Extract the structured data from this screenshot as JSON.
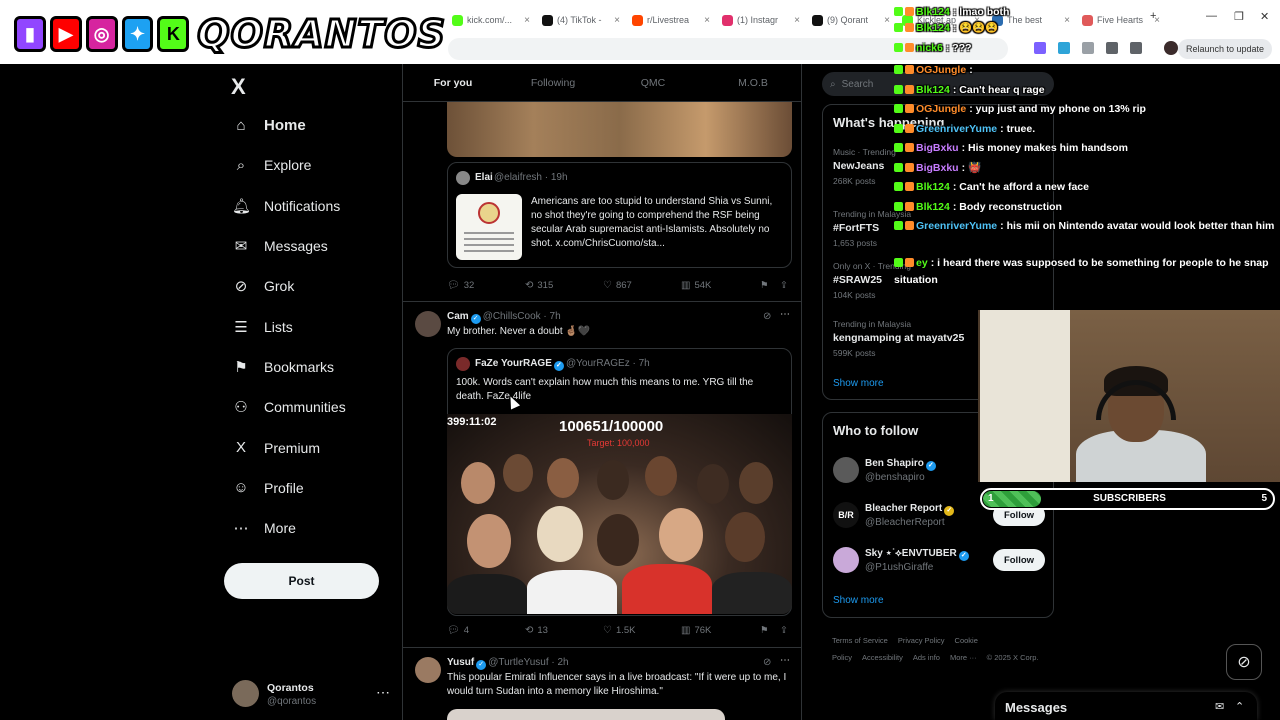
{
  "browser": {
    "tabs": [
      {
        "label": "kick.com/...",
        "color": "#53fc18"
      },
      {
        "label": "(4) TikTok -",
        "color": "#111111"
      },
      {
        "label": "r/Livestrea",
        "color": "#ff4500"
      },
      {
        "label": "(1) Instagr",
        "color": "#e1306c"
      },
      {
        "label": "(9) Qorant",
        "color": "#111111"
      },
      {
        "label": "Kicklet.ap",
        "color": "#53fc18"
      },
      {
        "label": "The best",
        "color": "#2b6cb0"
      },
      {
        "label": "Five Hearts",
        "color": "#e05a5a"
      }
    ],
    "new_tab": "+",
    "relaunch_label": "Relaunch to update"
  },
  "banner": {
    "name": "QORANTOS",
    "icons": [
      "twitch-icon",
      "youtube-icon",
      "instagram-icon",
      "twitter-icon",
      "kick-icon"
    ]
  },
  "nav": {
    "logo": "X",
    "items": [
      {
        "label": "Home",
        "icon": "⌂",
        "active": true
      },
      {
        "label": "Explore",
        "icon": "⌕"
      },
      {
        "label": "Notifications",
        "icon": "🔔︎"
      },
      {
        "label": "Messages",
        "icon": "✉"
      },
      {
        "label": "Grok",
        "icon": "⊘"
      },
      {
        "label": "Lists",
        "icon": "☰"
      },
      {
        "label": "Bookmarks",
        "icon": "⚑"
      },
      {
        "label": "Communities",
        "icon": "⚇"
      },
      {
        "label": "Premium",
        "icon": "X"
      },
      {
        "label": "Profile",
        "icon": "☺"
      },
      {
        "label": "More",
        "icon": "⋯"
      }
    ],
    "post_label": "Post",
    "account": {
      "name": "Qorantos",
      "handle": "@qorantos",
      "more": "⋯"
    }
  },
  "feed": {
    "tabs": [
      "For you",
      "Following",
      "QMC",
      "M.O.B"
    ],
    "quote1": {
      "name": "Elai",
      "handle": "@elaifresh · 19h",
      "text": "Americans are too stupid to understand Shia vs Sunni, no shot they're going to comprehend the RSF being secular Arab supremacist anti-Islamists. Absolutely no shot.  x.com/ChrisCuomo/sta..."
    },
    "actions1": {
      "reply": "32",
      "repost": "315",
      "like": "867",
      "views": "54K"
    },
    "tweet2": {
      "name": "Cam",
      "handle": "@ChillsCook · 7h",
      "text": "My brother. Never a doubt 🤞🏽🖤",
      "quote": {
        "name": "FaZe YourRAGE",
        "handle": "@YourRAGEz · 7h",
        "text": "100k. Words can't explain how much this means to me. YRG till the death. FaZe 4life"
      },
      "video": {
        "timer": "399:11:02",
        "count": "100651/100000",
        "target": "Target: 100,000"
      }
    },
    "actions2": {
      "reply": "4",
      "repost": "13",
      "like": "1.5K",
      "views": "76K"
    },
    "tweet3": {
      "name": "Yusuf",
      "handle": "@TurtleYusuf · 2h",
      "text": "This popular Emirati Influencer says in a live broadcast: \"If it were up to me, I would turn Sudan into a memory like Hiroshima.\""
    }
  },
  "right": {
    "search_placeholder": "Search",
    "happening_title": "What's happening",
    "trends": [
      {
        "category": "Music · Trending",
        "name": "NewJeans",
        "count": "268K posts"
      },
      {
        "category": "Trending in Malaysia",
        "name": "#FortFTS",
        "count": "1,653 posts"
      },
      {
        "category": "Only on X · Trending",
        "name": "#SRAW25",
        "count": "104K posts"
      },
      {
        "category": "Trending in Malaysia",
        "name": "kengnamping at mayatv25",
        "count": "599K posts"
      }
    ],
    "show_more": "Show more",
    "wtf_title": "Who to follow",
    "wtf": [
      {
        "name": "Ben Shapiro",
        "handle": "@benshapiro",
        "button": "Follow",
        "avatar": "#5a5a5a",
        "badge": "blue"
      },
      {
        "name": "Bleacher Report",
        "handle": "@BleacherReport",
        "button": "Follow",
        "avatar": "#111111",
        "badge": "gold",
        "mark": "B/R"
      },
      {
        "name": "Sky ⋆˙⟡ENVTUBER",
        "handle": "@P1ushGiraffe",
        "button": "Follow",
        "avatar": "#c9a9d9",
        "badge": "blue"
      }
    ],
    "footer": [
      "Terms of Service",
      "Privacy Policy",
      "Cookie Policy",
      "Accessibility",
      "Ads info",
      "More ···",
      "© 2025 X Corp."
    ],
    "messages_label": "Messages"
  },
  "chat": {
    "messages": [
      {
        "user": "Blk124",
        "text": "lmao both",
        "color": "#53fc18"
      },
      {
        "user": "Blk124",
        "text": "😫😫😫",
        "color": "#53fc18"
      },
      {
        "user": "nick6",
        "text": "???",
        "color": "#53fc18"
      },
      {
        "user": "OGJungle",
        "text": "",
        "color": "#ff8c2a"
      },
      {
        "user": "Blk124",
        "text": "Can't hear q rage",
        "color": "#53fc18"
      },
      {
        "user": "OGJungle",
        "text": "yup just    and my phone on 13% rip",
        "color": "#ff8c2a"
      },
      {
        "user": "GreenriverYume",
        "text": "truee.",
        "color": "#4fc3f7"
      },
      {
        "user": "BigBxku",
        "text": "His money makes him handsom",
        "color": "#c77dff"
      },
      {
        "user": "BigBxku",
        "text": "👹",
        "color": "#c77dff"
      },
      {
        "user": "Blk124",
        "text": "Can't he afford a new face",
        "color": "#53fc18"
      },
      {
        "user": "Blk124",
        "text": "Body reconstruction",
        "color": "#53fc18"
      },
      {
        "user": "GreenriverYume",
        "text": "his mii on Nintendo avatar would look better than him",
        "color": "#4fc3f7"
      },
      {
        "user": "ey",
        "text": "i heard there was supposed to be something for people to he snap situation",
        "color": "#53fc18"
      }
    ]
  },
  "subs": {
    "current": "1",
    "label": "SUBSCRIBERS",
    "goal": "5",
    "progress": 0.2
  }
}
